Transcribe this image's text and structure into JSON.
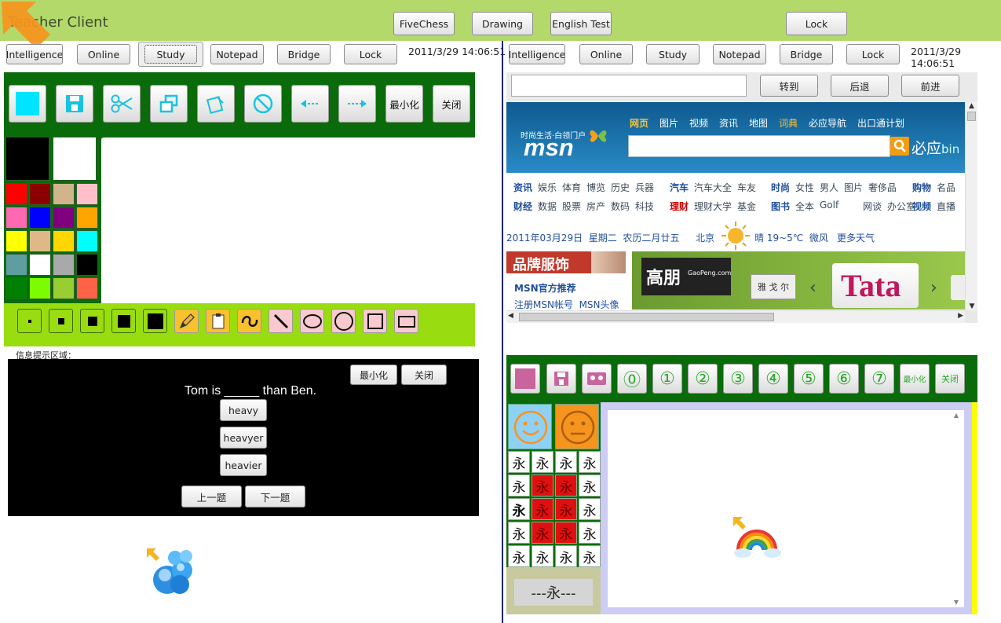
{
  "app": {
    "title": "Teacher Client"
  },
  "top_tabs": [
    "FiveChess",
    "Drawing",
    "English Test",
    "Lock"
  ],
  "nav_tabs": [
    "Intelligence",
    "Online",
    "Study",
    "Notepad",
    "Bridge",
    "Lock"
  ],
  "datetime": "2011/3/29 14:06:51",
  "toolbar": {
    "minimize": "最小化",
    "close": "关闭"
  },
  "palette": [
    "#000000",
    "#ffffff",
    "#ff0000",
    "#8b0000",
    "#d2b48c",
    "#ffc0cb",
    "#ff69b4",
    "#0000ff",
    "#800080",
    "#ffa500",
    "#ffff00",
    "#deb887",
    "#ffd700",
    "#00ffff",
    "#5f9ea0",
    "#ffffff",
    "#a9a9a9",
    "#000000",
    "#008000",
    "#7cfc00",
    "#9acd32",
    "#ff6347"
  ],
  "info": {
    "label": "信息提示区域：",
    "question_pre": "Tom is ",
    "question_blank": "_____",
    "question_post": " than Ben.",
    "options": [
      "heavy",
      "heavyer",
      "heavier"
    ],
    "prev": "上一题",
    "next": "下一题"
  },
  "browser": {
    "address_value": "",
    "go": "转到",
    "back": "后退",
    "forward": "前进"
  },
  "msn": {
    "slogan": "时尚生活·白领门户",
    "logo": "msn",
    "nav": [
      "网页",
      "图片",
      "视频",
      "资讯",
      "地图",
      "词典",
      "必应导航",
      "出口通计划"
    ],
    "search_brand": "必应",
    "search_brand_sub": "bin",
    "row1": [
      "资讯",
      "娱乐",
      "体育",
      "博览",
      "历史",
      "兵器",
      "汽车",
      "汽车大全",
      "车友",
      "时尚",
      "女性",
      "男人",
      "图片",
      "奢侈品",
      "购物",
      "名品"
    ],
    "row2": [
      "财经",
      "数据",
      "股票",
      "房产",
      "数码",
      "科技",
      "理财",
      "理财大学",
      "基金",
      "图书",
      "全本",
      "Golf",
      "网谈",
      "办公室",
      "视频",
      "直播"
    ],
    "weather_date": "2011年03月29日  星期二  农历二月廿五",
    "weather_city": "北京",
    "weather_text": "晴 19~5℃  微风",
    "weather_more": "更多天气",
    "brand_banner": "品牌服饰",
    "recommend": "MSN官方推荐",
    "recommend_links": "注册MSN帐号  MSN头像",
    "ad_title": "高朋",
    "ad_sub": "GaoPeng.com",
    "ad_button": "雅 戈 尔",
    "ad_brand": "Tata"
  },
  "calligraphy": {
    "numbers": [
      "⓪",
      "①",
      "②",
      "③",
      "④",
      "⑤",
      "⑥",
      "⑦"
    ],
    "char": "永",
    "preview": "---永---"
  }
}
